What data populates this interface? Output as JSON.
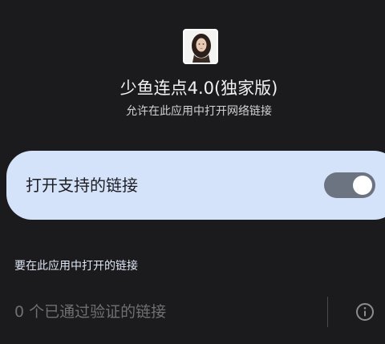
{
  "app": {
    "icon": "app-photo-icon",
    "name": "少鱼连点4.0(独家版)",
    "subtitle": "允许在此应用中打开网络链接"
  },
  "open_supported_links": {
    "label": "打开支持的链接",
    "enabled": true
  },
  "links_section": {
    "heading": "要在此应用中打开的链接",
    "verified_links_text": "0 个已通过验证的链接",
    "info_icon": "info-icon"
  },
  "colors": {
    "background": "#1b1b1d",
    "card": "#d5e3fa",
    "switch_track": "#6b7480",
    "muted_text": "#6f6f74"
  }
}
